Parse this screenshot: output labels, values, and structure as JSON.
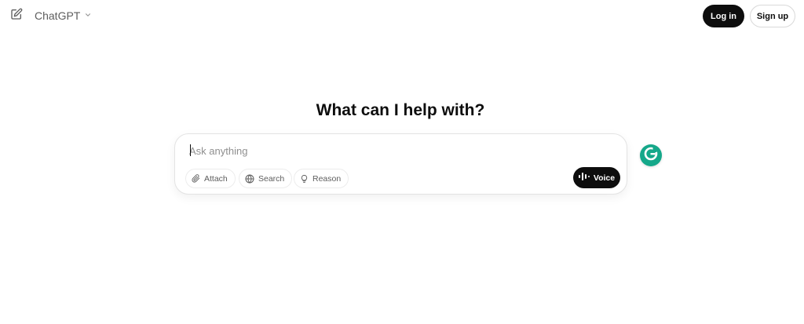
{
  "header": {
    "new_chat_icon": "pencil-square-icon",
    "model_name": "ChatGPT",
    "model_dropdown_icon": "chevron-down-icon",
    "login_label": "Log in",
    "signup_label": "Sign up"
  },
  "main": {
    "title": "What can I help with?"
  },
  "composer": {
    "placeholder": "Ask anything",
    "value": "",
    "tools": [
      {
        "label": "Attach",
        "icon": "paperclip-icon"
      },
      {
        "label": "Search",
        "icon": "globe-icon"
      },
      {
        "label": "Reason",
        "icon": "lightbulb-icon"
      }
    ],
    "voice_label": "Voice",
    "voice_icon": "waveform-icon"
  },
  "extension": {
    "grammarly_icon": "grammarly-icon",
    "grammarly_letter": "G"
  },
  "colors": {
    "primary_button_bg": "#0d0d0d",
    "grammarly_green": "#15a88a",
    "muted_text": "#5d5d5d",
    "placeholder_text": "#8f8f8f"
  }
}
